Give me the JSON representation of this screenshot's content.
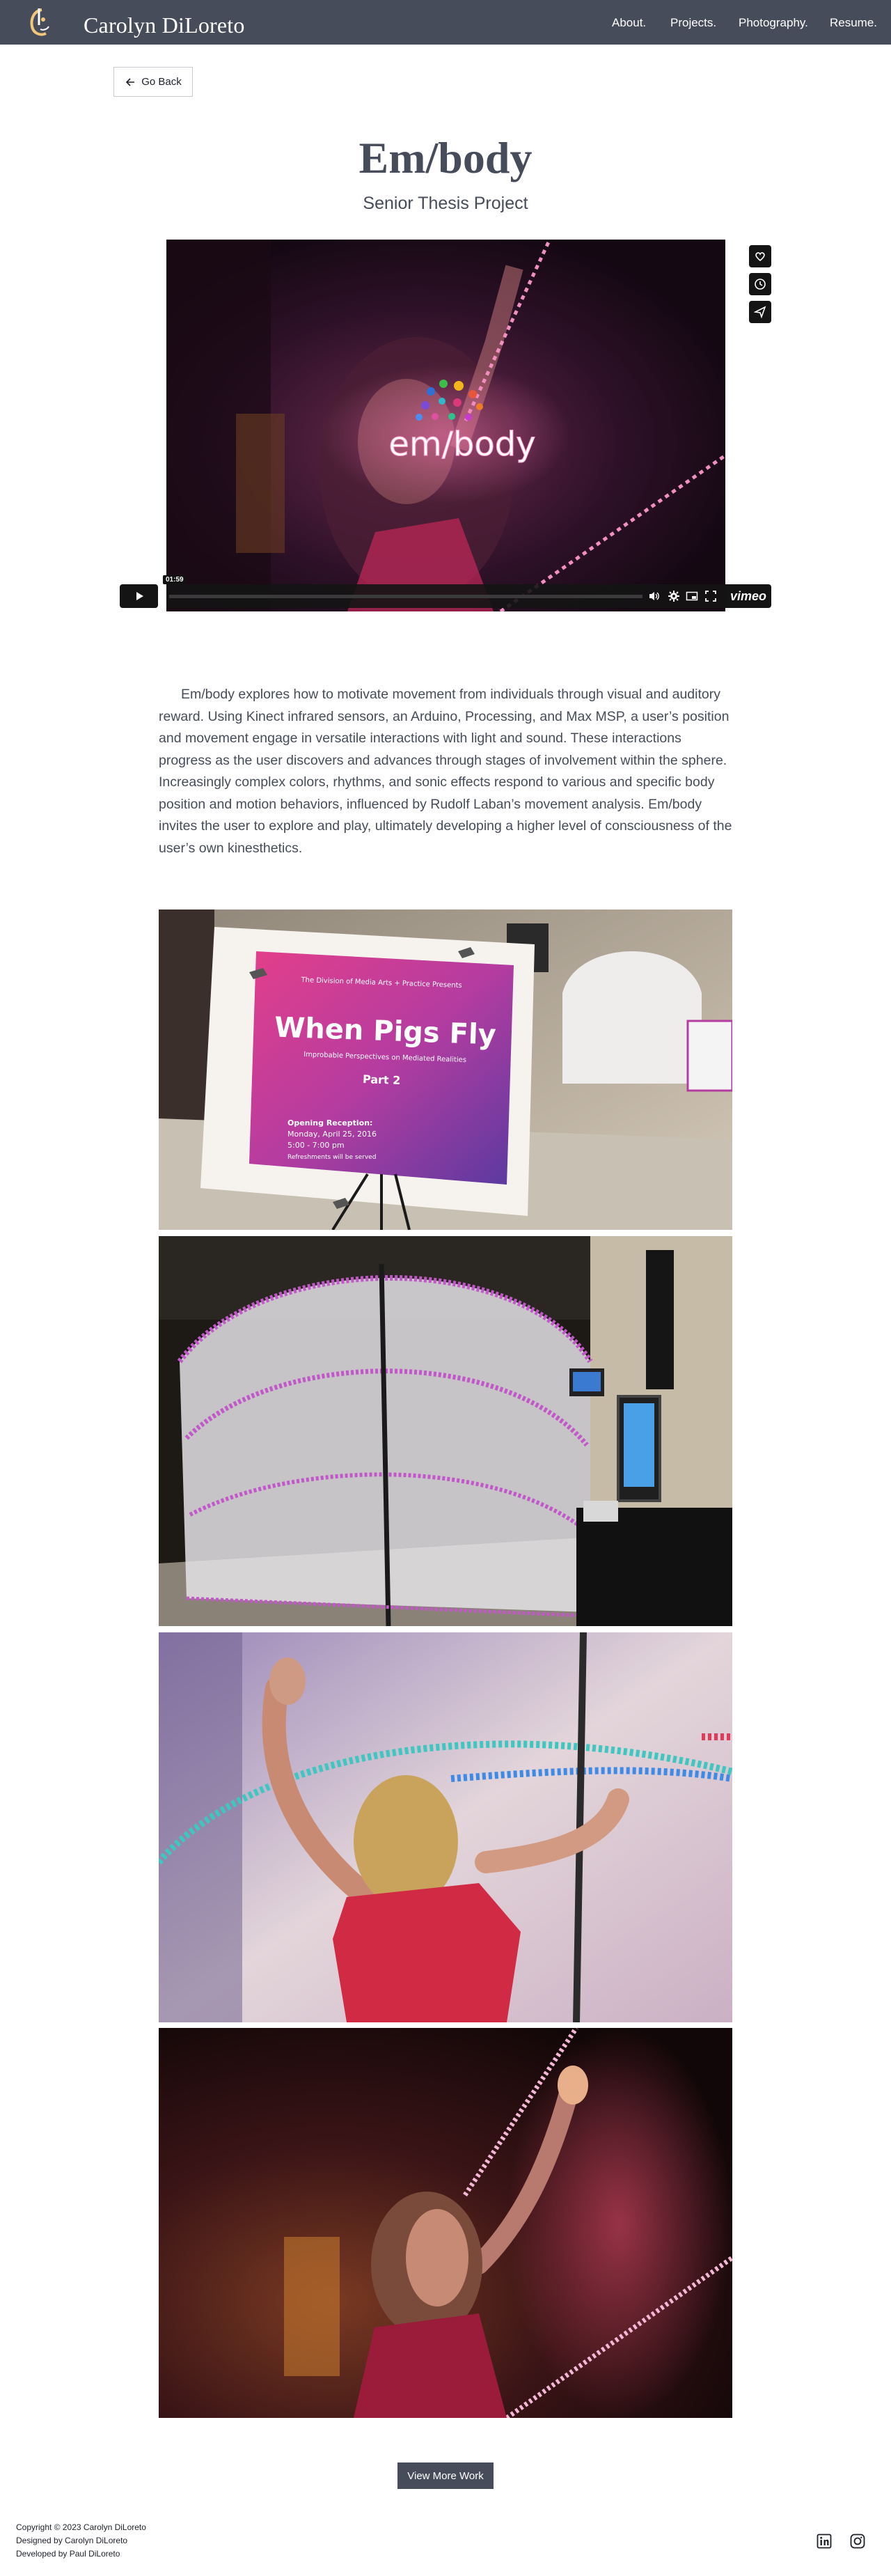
{
  "header": {
    "brand": "Carolyn DiLoreto",
    "nav": [
      "About.",
      "Projects.",
      "Photography.",
      "Resume."
    ]
  },
  "go_back_label": "Go Back",
  "project": {
    "title": "Em/body",
    "subtitle": "Senior Thesis Project"
  },
  "video": {
    "logo_text": "em/body",
    "timestamp": "01:59",
    "provider": "vimeo"
  },
  "description": "Em/body explores how to motivate movement from individuals through visual and auditory reward. Using Kinect infrared sensors, an Arduino, Processing, and Max MSP, a user’s position and movement engage in versatile interactions with light and sound. These interactions progress as the user discovers and advances through stages of involvement within the sphere. Increasingly complex colors, rhythms, and sonic effects respond to various and specific body position and motion behaviors, influenced by Rudolf Laban’s movement analysis. Em/body invites the user to explore and play, ultimately developing a higher level of consciousness of the user’s own kinesthetics.",
  "poster": {
    "presenter": "The Division of Media Arts + Practice Presents",
    "title": "When Pigs Fly",
    "tagline": "Improbable Perspectives on Mediated Realities",
    "part": "Part 2",
    "reception_label": "Opening Reception:",
    "reception_date": "Monday, April 25, 2016",
    "reception_time": "5:00 - 7:00 pm",
    "refreshments": "Refreshments will be served"
  },
  "view_more_label": "View More Work",
  "footer": {
    "copyright": "Copyright © 2023 Carolyn DiLoreto",
    "designed": "Designed by Carolyn DiLoreto",
    "developed": "Developed by Paul DiLoreto"
  },
  "colors": {
    "header_bg": "#474c5a",
    "text": "#474c5a",
    "accent_pink": "#e43a8c"
  }
}
